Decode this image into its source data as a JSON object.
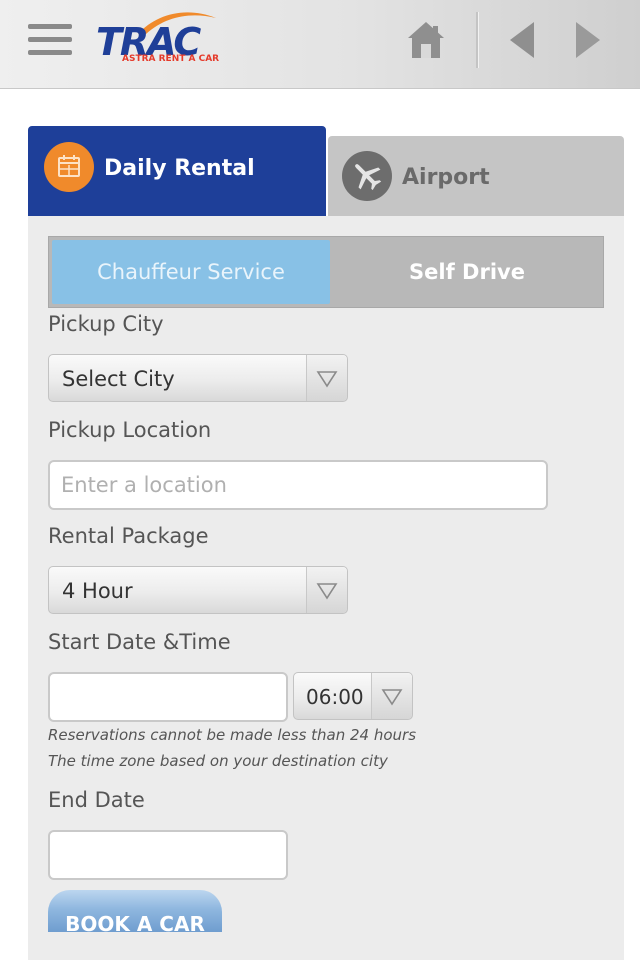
{
  "header": {
    "logo_text": "TRAC",
    "logo_subtext": "ASTRA RENT A CAR",
    "menu_icon": "hamburger-icon",
    "home_icon": "home-icon",
    "back_icon": "arrow-left-icon",
    "forward_icon": "arrow-right-icon"
  },
  "tabs": [
    {
      "label": "Daily Rental",
      "icon": "calendar-icon",
      "active": true
    },
    {
      "label": "Airport",
      "icon": "airplane-icon",
      "active": false
    }
  ],
  "service": {
    "chauffeur_label": "Chauffeur Service",
    "self_drive_label": "Self Drive",
    "selected": "Chauffeur Service"
  },
  "form": {
    "pickup_city_label": "Pickup City",
    "pickup_city_value": "Select City",
    "pickup_location_label": "Pickup Location",
    "pickup_location_placeholder": "Enter a location",
    "rental_package_label": "Rental Package",
    "rental_package_value": "4 Hour",
    "start_label": "Start Date &Time",
    "start_date_value": "",
    "start_time_value": "06:00",
    "note_1": "Reservations cannot be made less than 24 hours",
    "note_2": "The time zone based on your destination city",
    "end_label": "End Date",
    "end_date_value": "",
    "book_button": "BOOK A CAR"
  },
  "colors": {
    "brand_blue": "#1e3f99",
    "brand_orange": "#f08a2b",
    "accent_light_blue": "#88c1e6"
  }
}
